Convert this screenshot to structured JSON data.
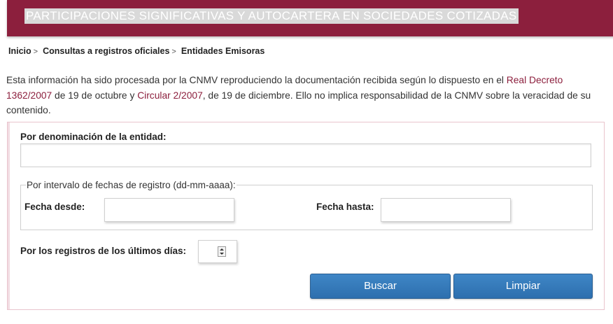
{
  "header": {
    "title": "PARTICIPACIONES SIGNIFICATIVAS Y AUTOCARTERA EN SOCIEDADES COTIZADAS"
  },
  "breadcrumb": {
    "items": [
      "Inicio",
      "Consultas a registros oficiales",
      "Entidades Emisoras"
    ],
    "separator": ">"
  },
  "intro": {
    "text_1": "Esta información ha sido procesada por la CNMV reproduciendo la documentación recibida según lo dispuesto en el ",
    "link_1": "Real Decreto 1362/2007",
    "text_2": " de 19 de octubre y ",
    "link_2": "Circular 2/2007",
    "text_3": ", de 19 de diciembre. Ello no implica responsabilidad de la CNMV sobre la veracidad de su contenido."
  },
  "form": {
    "entity_label": "Por denominación de la entidad:",
    "entity_value": "",
    "dates_legend": "Por intervalo de fechas de registro (dd-mm-aaaa):",
    "date_from_label": "Fecha desde:",
    "date_from_value": "",
    "date_to_label": "Fecha hasta:",
    "date_to_value": "",
    "days_label": "Por los registros de los últimos días:",
    "days_value": "",
    "search_button": "Buscar",
    "clear_button": "Limpiar"
  },
  "colors": {
    "brand": "#8c1f3d",
    "button": "#3478b8",
    "link": "#8c1f3d"
  }
}
